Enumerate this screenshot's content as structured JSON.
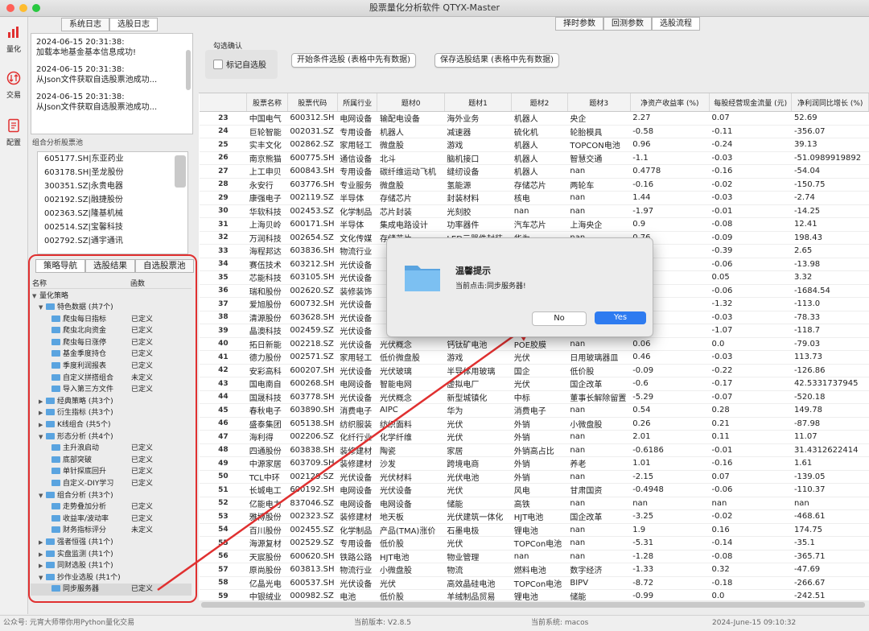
{
  "window": {
    "title": "股票量化分析软件 QTYX-Master"
  },
  "sidebar": {
    "items": [
      {
        "label": "量化",
        "icon": "bar-chart-icon"
      },
      {
        "label": "交易",
        "icon": "trade-icon"
      },
      {
        "label": "配置",
        "icon": "config-icon"
      }
    ]
  },
  "log_tabs": [
    "系统日志",
    "选股日志"
  ],
  "logs": [
    {
      "time": "2024-06-15 20:31:38:",
      "msg": "加载本地基金基本信息成功!"
    },
    {
      "time": "2024-06-15 20:31:38:",
      "msg": "从Json文件获取自选股票池成功..."
    },
    {
      "time": "2024-06-15 20:31:38:",
      "msg": "从Json文件获取自选股票池成功..."
    }
  ],
  "pool": {
    "label": "组合分析股票池",
    "items": [
      "605177.SH|东亚药业",
      "603178.SH|圣龙股份",
      "300351.SZ|永贵电器",
      "002192.SZ|融捷股份",
      "002363.SZ|隆基机械",
      "002514.SZ|宝馨科技",
      "002792.SZ|通宇通讯"
    ]
  },
  "strategy_tabs": [
    "策略导航",
    "选股结果",
    "自选股票池"
  ],
  "tree": {
    "col_name": "名称",
    "col_func": "函数",
    "root": "量化策略",
    "nodes": [
      {
        "lv": 1,
        "open": true,
        "folder": true,
        "label": "特色数据 (共7个)",
        "def": ""
      },
      {
        "lv": 2,
        "folder": true,
        "label": "爬虫每日指标",
        "def": "已定义"
      },
      {
        "lv": 2,
        "folder": true,
        "label": "爬虫北向资金",
        "def": "已定义"
      },
      {
        "lv": 2,
        "folder": true,
        "label": "爬虫每日涨停",
        "def": "已定义"
      },
      {
        "lv": 2,
        "folder": true,
        "label": "基金季度持仓",
        "def": "已定义"
      },
      {
        "lv": 2,
        "folder": true,
        "label": "季度利润报表",
        "def": "已定义"
      },
      {
        "lv": 2,
        "folder": true,
        "label": "自定义拼搭组合",
        "def": "未定义"
      },
      {
        "lv": 2,
        "folder": true,
        "label": "导入第三方文件",
        "def": "已定义"
      },
      {
        "lv": 1,
        "open": false,
        "folder": true,
        "label": "经典策略 (共3个)",
        "def": ""
      },
      {
        "lv": 1,
        "open": false,
        "folder": true,
        "label": "衍生指标 (共3个)",
        "def": ""
      },
      {
        "lv": 1,
        "open": false,
        "folder": true,
        "label": "K线组合 (共5个)",
        "def": ""
      },
      {
        "lv": 1,
        "open": true,
        "folder": true,
        "label": "形态分析 (共4个)",
        "def": ""
      },
      {
        "lv": 2,
        "folder": true,
        "label": "主升浪启动",
        "def": "已定义"
      },
      {
        "lv": 2,
        "folder": true,
        "label": "底部突破",
        "def": "已定义"
      },
      {
        "lv": 2,
        "folder": true,
        "label": "单针探底回升",
        "def": "已定义"
      },
      {
        "lv": 2,
        "folder": true,
        "label": "自定义-DIY学习",
        "def": "已定义"
      },
      {
        "lv": 1,
        "open": true,
        "folder": true,
        "label": "组合分析 (共3个)",
        "def": ""
      },
      {
        "lv": 2,
        "folder": true,
        "label": "走势叠加分析",
        "def": "已定义"
      },
      {
        "lv": 2,
        "folder": true,
        "label": "收益率/波动率",
        "def": "已定义"
      },
      {
        "lv": 2,
        "folder": true,
        "label": "财务指标评分",
        "def": "未定义"
      },
      {
        "lv": 1,
        "open": false,
        "folder": true,
        "label": "强者恒强 (共1个)",
        "def": ""
      },
      {
        "lv": 1,
        "open": false,
        "folder": true,
        "label": "实盘监测 (共1个)",
        "def": ""
      },
      {
        "lv": 1,
        "open": false,
        "folder": true,
        "label": "同财选股 (共1个)",
        "def": ""
      },
      {
        "lv": 1,
        "open": true,
        "folder": true,
        "label": "抄作业选股 (共1个)",
        "def": ""
      },
      {
        "lv": 2,
        "folder": true,
        "label": "同步服务器",
        "def": "已定义",
        "selected": true
      }
    ]
  },
  "top_tabs": [
    "择时参数",
    "回测参数",
    "选股流程"
  ],
  "confirm": {
    "group": "勾选确认",
    "checkbox": "标记自选股"
  },
  "buttons": {
    "start": "开始条件选股 (表格中先有数据)",
    "save": "保存选股结果 (表格中先有数据)"
  },
  "table": {
    "headers": [
      "",
      "股票名称",
      "股票代码",
      "所属行业",
      "题材0",
      "题材1",
      "题材2",
      "题材3",
      "净资产收益率 (%)",
      "每股经营现金流量 (元)",
      "净利润同比增长 (%)"
    ],
    "rows": [
      [
        "23",
        "中国电气",
        "600312.SH",
        "电网设备",
        "输配电设备",
        "海外业务",
        "机器人",
        "央企",
        "2.27",
        "0.07",
        "52.69"
      ],
      [
        "24",
        "巨轮智能",
        "002031.SZ",
        "专用设备",
        "机器人",
        "减速器",
        "硫化机",
        "轮胎模具",
        "-0.58",
        "-0.11",
        "-356.07"
      ],
      [
        "25",
        "实丰文化",
        "002862.SZ",
        "家用轻工",
        "微盘股",
        "游戏",
        "机器人",
        "TOPCON电池",
        "0.96",
        "-0.24",
        "39.13"
      ],
      [
        "26",
        "南京熊猫",
        "600775.SH",
        "通信设备",
        "北斗",
        "脑机接口",
        "机器人",
        "智慧交通",
        "-1.1",
        "-0.03",
        "-51.0989919892"
      ],
      [
        "27",
        "上工申贝",
        "600843.SH",
        "专用设备",
        "碳纤维运动飞机",
        "缝纫设备",
        "机器人",
        "nan",
        "0.4778",
        "-0.16",
        "-54.04"
      ],
      [
        "28",
        "永安行",
        "603776.SH",
        "专业服务",
        "微盘股",
        "氢能源",
        "存储芯片",
        "两轮车",
        "-0.16",
        "-0.02",
        "-150.75"
      ],
      [
        "29",
        "康强电子",
        "002119.SZ",
        "半导体",
        "存储芯片",
        "封装材料",
        "核电",
        "nan",
        "1.44",
        "-0.03",
        "-2.74"
      ],
      [
        "30",
        "华软科技",
        "002453.SZ",
        "化学制品",
        "芯片封装",
        "光刻胶",
        "nan",
        "nan",
        "-1.97",
        "-0.01",
        "-14.25"
      ],
      [
        "31",
        "上海贝岭",
        "600171.SH",
        "半导体",
        "集成电路设计",
        "功率器件",
        "汽车芯片",
        "上海央企",
        "0.9",
        "-0.08",
        "12.41"
      ],
      [
        "32",
        "万润科技",
        "002654.SZ",
        "文化传媒",
        "存储芯片",
        "LED元器件封装",
        "华为",
        "nan",
        "0.76",
        "-0.09",
        "198.43"
      ],
      [
        "33",
        "海程邦达",
        "603836.SH",
        "物流行业",
        "",
        "",
        "",
        "",
        "75",
        "-0.39",
        "2.65"
      ],
      [
        "34",
        "赛伍技术",
        "603212.SH",
        "光伏设备",
        "",
        "",
        "",
        "",
        "93",
        "-0.06",
        "-13.98"
      ],
      [
        "35",
        "芯能科技",
        "603105.SH",
        "光伏设备",
        "",
        "",
        "",
        "",
        "5",
        "0.05",
        "3.32"
      ],
      [
        "36",
        "瑞和股份",
        "002620.SZ",
        "装修装饰",
        "",
        "",
        "",
        "",
        "74",
        "-0.06",
        "-1684.54"
      ],
      [
        "37",
        "爱旭股份",
        "600732.SH",
        "光伏设备",
        "",
        "",
        "",
        "",
        "06",
        "-1.32",
        "-113.0"
      ],
      [
        "38",
        "清源股份",
        "603628.SH",
        "光伏设备",
        "",
        "",
        "",
        "",
        "38",
        "-0.03",
        "-78.33"
      ],
      [
        "39",
        "晶澳科技",
        "002459.SZ",
        "光伏设备",
        "",
        "",
        "",
        "",
        "38",
        "-1.07",
        "-118.7"
      ],
      [
        "40",
        "拓日新能",
        "002218.SZ",
        "光伏设备",
        "光伏概念",
        "钙钛矿电池",
        "POE胶膜",
        "nan",
        "0.06",
        "0.0",
        "-79.03"
      ],
      [
        "41",
        "德力股份",
        "002571.SZ",
        "家用轻工",
        "低价微盘股",
        "游戏",
        "光伏",
        "日用玻璃器皿",
        "0.46",
        "-0.03",
        "113.73"
      ],
      [
        "42",
        "安彩高科",
        "600207.SH",
        "光伏设备",
        "光伏玻璃",
        "半导体用玻璃",
        "国企",
        "低价股",
        "-0.09",
        "-0.22",
        "-126.86"
      ],
      [
        "43",
        "国电南自",
        "600268.SH",
        "电网设备",
        "智能电网",
        "虚拟电厂",
        "光伏",
        "国企改革",
        "-0.6",
        "-0.17",
        "42.5331737945"
      ],
      [
        "44",
        "国晟科技",
        "603778.SH",
        "光伏设备",
        "光伏概念",
        "新型城镇化",
        "中标",
        "董事长解除留置",
        "-5.29",
        "-0.07",
        "-520.18"
      ],
      [
        "45",
        "春秋电子",
        "603890.SH",
        "消费电子",
        "AIPC",
        "华为",
        "消费电子",
        "nan",
        "0.54",
        "0.28",
        "149.78"
      ],
      [
        "46",
        "盛泰集团",
        "605138.SH",
        "纺织服装",
        "纺织面料",
        "光伏",
        "外销",
        "小微盘股",
        "0.26",
        "0.21",
        "-87.98"
      ],
      [
        "47",
        "海利得",
        "002206.SZ",
        "化纤行业",
        "化学纤维",
        "光伏",
        "外销",
        "nan",
        "2.01",
        "0.11",
        "11.07"
      ],
      [
        "48",
        "四通股份",
        "603838.SH",
        "装修建材",
        "陶瓷",
        "家居",
        "外销高占比",
        "nan",
        "-0.6186",
        "-0.01",
        "31.4312622414"
      ],
      [
        "49",
        "中源家居",
        "603709.SH",
        "装修建材",
        "沙发",
        "跨境电商",
        "外销",
        "养老",
        "1.01",
        "-0.16",
        "1.61"
      ],
      [
        "50",
        "TCL中环",
        "002129.SZ",
        "光伏设备",
        "光伏材料",
        "光伏电池",
        "外销",
        "nan",
        "-2.15",
        "0.07",
        "-139.05"
      ],
      [
        "51",
        "长城电工",
        "600192.SH",
        "电网设备",
        "光伏设备",
        "光伏",
        "风电",
        "甘肃国资",
        "-0.4948",
        "-0.06",
        "-110.37"
      ],
      [
        "52",
        "亿能电力",
        "837046.SZ",
        "电网设备",
        "电网设备",
        "储能",
        "高铁",
        "nan",
        "nan",
        "nan",
        "nan"
      ],
      [
        "53",
        "雅博股份",
        "002323.SZ",
        "装修建材",
        "地天板",
        "光伏建筑一体化",
        "HJT电池",
        "国企改革",
        "-3.25",
        "-0.02",
        "-468.61"
      ],
      [
        "54",
        "百川股份",
        "002455.SZ",
        "化学制品",
        "产品(TMA)涨价",
        "石墨电极",
        "锂电池",
        "nan",
        "1.9",
        "0.16",
        "174.75"
      ],
      [
        "55",
        "海源复材",
        "002529.SZ",
        "专用设备",
        "低价股",
        "光伏",
        "TOPCon电池",
        "nan",
        "-5.31",
        "-0.14",
        "-35.1"
      ],
      [
        "56",
        "天宸股份",
        "600620.SH",
        "铁路公路",
        "HJT电池",
        "物业管理",
        "nan",
        "nan",
        "-1.28",
        "-0.08",
        "-365.71"
      ],
      [
        "57",
        "原尚股份",
        "603813.SH",
        "物流行业",
        "小微盘股",
        "物流",
        "燃料电池",
        "数字经济",
        "-1.33",
        "0.32",
        "-47.69"
      ],
      [
        "58",
        "亿晶光电",
        "600537.SH",
        "光伏设备",
        "光伏",
        "高效晶硅电池",
        "TOPCon电池",
        "BIPV",
        "-8.72",
        "-0.18",
        "-266.67"
      ],
      [
        "59",
        "中银绒业",
        "000982.SZ",
        "电池",
        "低价股",
        "羊绒制品贸易",
        "锂电池",
        "储能",
        "-0.99",
        "0.0",
        "-242.51"
      ]
    ]
  },
  "dialog": {
    "title": "温馨提示",
    "msg": "当前点击:同步服务器!",
    "no": "No",
    "yes": "Yes"
  },
  "status": {
    "left": "公众号: 元宵大师带你用Python量化交易",
    "version": "当前版本: V2.8.5",
    "system": "当前系统: macos",
    "date": "2024-June-15 09:10:32"
  },
  "colors": {
    "accent": "#e03030",
    "yes": "#2e7bf0",
    "folder": "#5aa4e0"
  }
}
